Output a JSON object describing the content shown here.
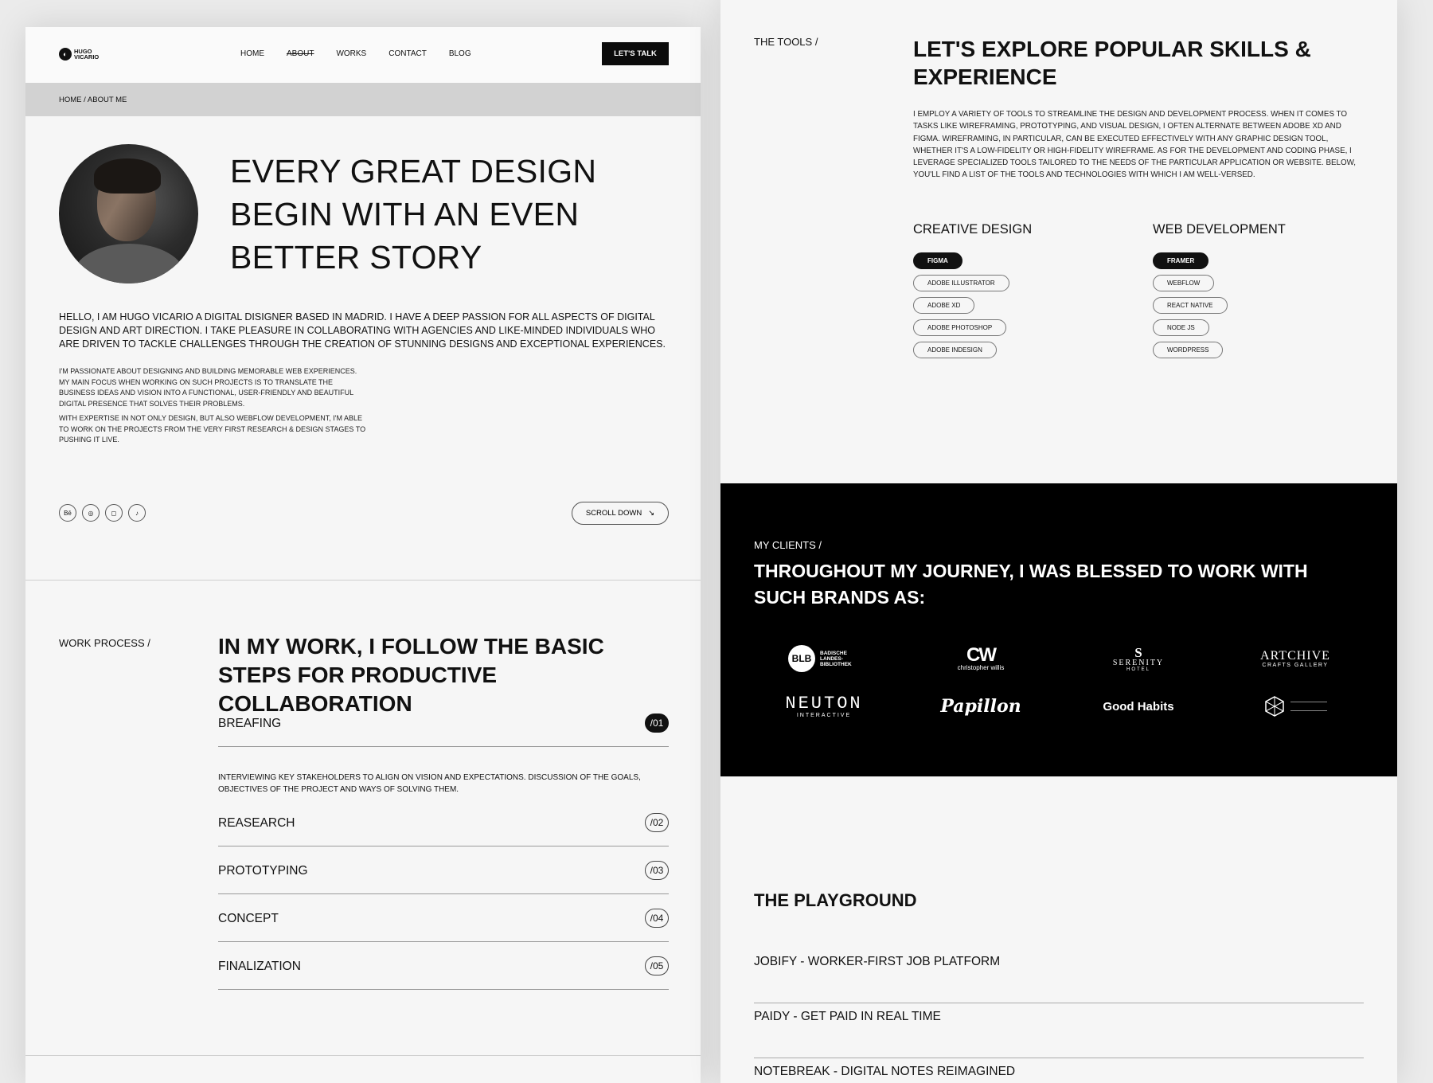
{
  "nav": {
    "logo_line1": "HUGO",
    "logo_line2": "VICARIO",
    "items": [
      "HOME",
      "ABOUT",
      "WORKS",
      "CONTACT",
      "BLOG"
    ],
    "cta": "LET'S TALK"
  },
  "breadcrumb": "HOME / ABOUT ME",
  "hero": {
    "title_line1": "EVERY GREAT DESIGN",
    "title_line2": "BEGIN WITH AN EVEN",
    "title_line3": "BETTER STORY",
    "intro": "HELLO, I AM HUGO VICARIO A DIGITAL DISIGNER BASED IN MADRID. I HAVE A DEEP PASSION FOR ALL ASPECTS OF DIGITAL DESIGN AND ART DIRECTION. I TAKE PLEASURE IN COLLABORATING WITH AGENCIES AND LIKE-MINDED INDIVIDUALS WHO ARE DRIVEN TO TACKLE CHALLENGES THROUGH THE CREATION OF STUNNING DESIGNS AND EXCEPTIONAL EXPERIENCES.",
    "para1": "I'M PASSIONATE ABOUT DESIGNING AND BUILDING MEMORABLE WEB EXPERIENCES. MY MAIN FOCUS WHEN WORKING ON SUCH PROJECTS IS TO TRANSLATE THE BUSINESS IDEAS AND VISION INTO A FUNCTIONAL, USER-FRIENDLY AND BEAUTIFUL DIGITAL PRESENCE THAT SOLVES THEIR PROBLEMS.",
    "para2": "WITH EXPERTISE IN NOT ONLY DESIGN, BUT ALSO WEBFLOW DEVELOPMENT, I'M ABLE TO WORK ON THE PROJECTS FROM THE VERY FIRST RESEARCH & DESIGN STAGES TO PUSHING IT LIVE.",
    "socials": [
      "Bē",
      "◎",
      "◻",
      "♪"
    ],
    "scroll": "SCROLL DOWN",
    "scroll_arrow": "↘"
  },
  "work_process": {
    "label": "WORK PROCESS /",
    "title": "IN MY WORK, I FOLLOW THE BASIC STEPS FOR PRODUCTIVE COLLABORATION",
    "steps": [
      {
        "name": "BREAFING",
        "num": "/01"
      },
      {
        "name": "REASEARCH",
        "num": "/02"
      },
      {
        "name": "PROTOTYPING",
        "num": "/03"
      },
      {
        "name": "CONCEPT",
        "num": "/04"
      },
      {
        "name": "FINALIZATION",
        "num": "/05"
      }
    ],
    "step1_desc": "INTERVIEWING KEY STAKEHOLDERS TO ALIGN ON VISION AND EXPECTATIONS. DISCUSSION OF THE GOALS, OBJECTIVES OF THE PROJECT AND WAYS OF SOLVING THEM."
  },
  "tools": {
    "label": "THE TOOLS /",
    "title": "LET'S EXPLORE POPULAR SKILLS & EXPERIENCE",
    "text": "I EMPLOY A VARIETY OF TOOLS TO STREAMLINE THE DESIGN AND DEVELOPMENT PROCESS. WHEN IT COMES TO TASKS LIKE WIREFRAMING, PROTOTYPING, AND VISUAL DESIGN, I OFTEN ALTERNATE BETWEEN ADOBE XD AND FIGMA. WIREFRAMING, IN PARTICULAR, CAN BE EXECUTED EFFECTIVELY WITH ANY GRAPHIC DESIGN TOOL, WHETHER IT'S A LOW-FIDELITY OR HIGH-FIDELITY WIREFRAME. AS FOR THE DEVELOPMENT AND CODING PHASE, I LEVERAGE SPECIALIZED TOOLS TAILORED TO THE NEEDS OF THE PARTICULAR APPLICATION OR WEBSITE. BELOW, YOU'LL FIND A LIST OF THE TOOLS AND TECHNOLOGIES WITH WHICH I AM WELL-VERSED.",
    "creative_head": "CREATIVE DESIGN",
    "creative": [
      "FIGMA",
      "ADOBE ILLUSTRATOR",
      "ADOBE XD",
      "ADOBE PHOTOSHOP",
      "ADOBE INDESIGN"
    ],
    "web_head": "WEB DEVELOPMENT",
    "web": [
      "FRAMER",
      "WEBFLOW",
      "REACT NATIVE",
      "NODE JS",
      "WORDPRESS"
    ]
  },
  "clients": {
    "label": "MY CLIENTS /",
    "title": "THROUGHOUT MY JOURNEY, I WAS BLESSED TO WORK WITH SUCH BRANDS AS:",
    "blb_mark": "BLB",
    "blb_text": "BADISCHE LANDES- BIBLIOTHEK",
    "cw_mark": "CW",
    "cw_text": "christopher willis",
    "serenity_mark": "S",
    "serenity_text": "SERENITY",
    "serenity_sub": "HOTEL",
    "artchive_text": "ARTCHIVE",
    "artchive_sub": "CRAFTS GALLERY",
    "neuton_text": "NEUTON",
    "neuton_sub": "INTERACTIVE",
    "papillon_text": "Papillon",
    "goodhabits_text": "Good Habits"
  },
  "playground": {
    "title": "THE PLAYGROUND",
    "items": [
      "JOBIFY - WORKER-FIRST JOB PLATFORM",
      "PAIDY - GET PAID IN REAL TIME",
      "NOTEBREAK - DIGITAL NOTES REIMAGINED"
    ]
  }
}
